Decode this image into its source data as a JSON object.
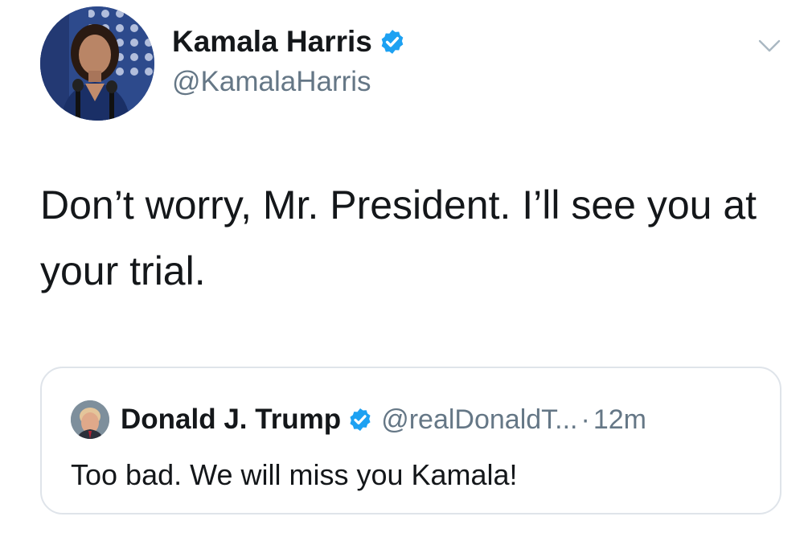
{
  "tweet": {
    "author": {
      "name": "Kamala Harris",
      "handle": "@KamalaHarris",
      "verified": true,
      "avatar_icon": "profile-photo-avatar"
    },
    "text": "Don’t worry, Mr. President. I’ll see you at your trial.",
    "menu_icon": "chevron-down-icon"
  },
  "quoted_tweet": {
    "author": {
      "name": "Donald J. Trump",
      "handle": "@realDonaldT...",
      "verified": true,
      "avatar_icon": "profile-photo-avatar"
    },
    "separator": "·",
    "time": "12m",
    "text": "Too bad. We will miss you Kamala!"
  },
  "colors": {
    "verified_blue": "#1da1f2",
    "text_primary": "#14171a",
    "text_secondary": "#657786",
    "border": "#dfe4ea"
  }
}
